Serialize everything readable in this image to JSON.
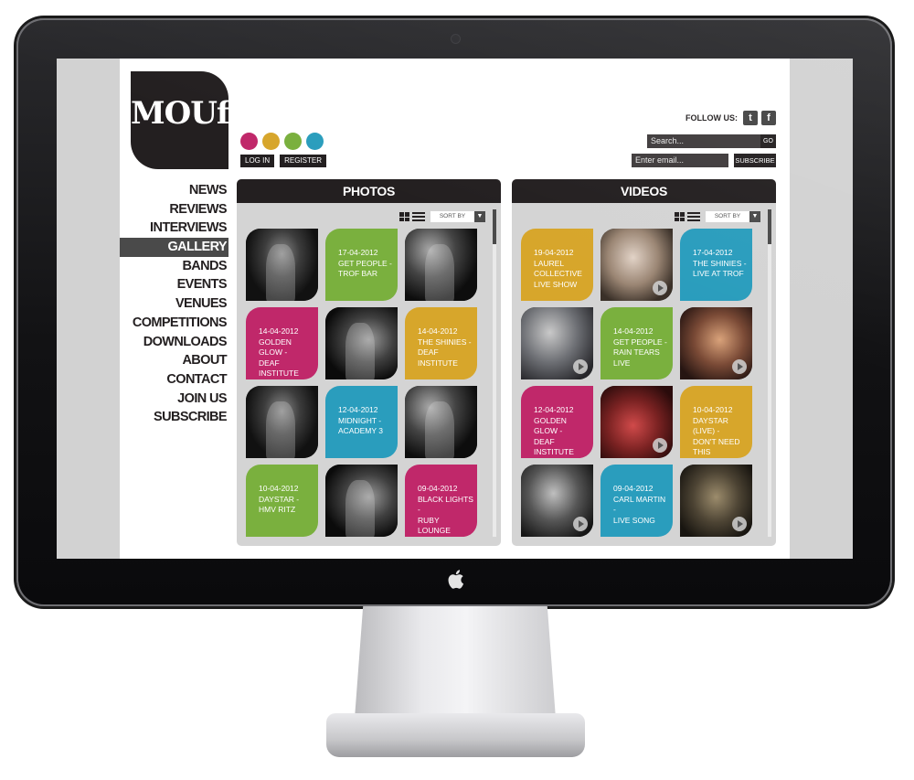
{
  "site": {
    "logo": "MOUf",
    "dots": [
      "#c0286a",
      "#d7a62b",
      "#7ab03e",
      "#2a9dbd"
    ],
    "auth": [
      "LOG IN",
      "REGISTER"
    ],
    "follow_label": "FOLLOW US:",
    "social": [
      {
        "icon": "twitter-icon",
        "glyph": "t"
      },
      {
        "icon": "facebook-icon",
        "glyph": "f"
      }
    ],
    "search": {
      "placeholder": "Search...",
      "go": "GO"
    },
    "newsletter": {
      "placeholder": "Enter email...",
      "button": "SUBSCRIBE"
    }
  },
  "nav": {
    "items": [
      "NEWS",
      "REVIEWS",
      "INTERVIEWS",
      "GALLERY",
      "BANDS",
      "EVENTS",
      "VENUES",
      "COMPETITIONS",
      "DOWNLOADS",
      "ABOUT",
      "CONTACT",
      "JOIN US",
      "SUBSCRIBE"
    ],
    "active": "GALLERY"
  },
  "photos": {
    "title": "PHOTOS",
    "sort_label": "SORT BY",
    "tiles": [
      {
        "kind": "photo"
      },
      {
        "kind": "text",
        "color": "#7ab03e",
        "lines": [
          "17-04-2012",
          "GET PEOPLE -",
          "TROF BAR"
        ]
      },
      {
        "kind": "photo"
      },
      {
        "kind": "text",
        "color": "#c0286a",
        "lines": [
          "14-04-2012",
          "GOLDEN GLOW -",
          "DEAF INSTITUTE"
        ]
      },
      {
        "kind": "photo"
      },
      {
        "kind": "text",
        "color": "#d7a62b",
        "lines": [
          "14-04-2012",
          "THE SHINIES -",
          "DEAF INSTITUTE"
        ]
      },
      {
        "kind": "photo"
      },
      {
        "kind": "text",
        "color": "#2a9dbd",
        "lines": [
          "12-04-2012",
          "MIDNIGHT -",
          "ACADEMY 3"
        ]
      },
      {
        "kind": "photo"
      },
      {
        "kind": "text",
        "color": "#7ab03e",
        "lines": [
          "10-04-2012",
          "DAYSTAR -",
          "HMV RITZ"
        ]
      },
      {
        "kind": "photo"
      },
      {
        "kind": "text",
        "color": "#c0286a",
        "lines": [
          "09-04-2012",
          "BLACK LIGHTS -",
          "RUBY LOUNGE"
        ]
      }
    ]
  },
  "videos": {
    "title": "VIDEOS",
    "sort_label": "SORT BY",
    "tiles": [
      {
        "kind": "text",
        "color": "#d7a62b",
        "lines": [
          "19-04-2012",
          "LAUREL",
          "COLLECTIVE",
          "LIVE SHOW"
        ]
      },
      {
        "kind": "video"
      },
      {
        "kind": "text",
        "color": "#2a9dbd",
        "lines": [
          "17-04-2012",
          "THE SHINIES -",
          "LIVE AT TROF"
        ]
      },
      {
        "kind": "video"
      },
      {
        "kind": "text",
        "color": "#7ab03e",
        "lines": [
          "14-04-2012",
          "GET PEOPLE -",
          "RAIN TEARS LIVE"
        ]
      },
      {
        "kind": "video"
      },
      {
        "kind": "text",
        "color": "#c0286a",
        "lines": [
          "12-04-2012",
          "GOLDEN GLOW -",
          "DEAF INSTITUTE"
        ]
      },
      {
        "kind": "video"
      },
      {
        "kind": "text",
        "color": "#d7a62b",
        "lines": [
          "10-04-2012",
          "DAYSTAR (LIVE) -",
          "DON'T NEED THIS"
        ]
      },
      {
        "kind": "video"
      },
      {
        "kind": "text",
        "color": "#2a9dbd",
        "lines": [
          "09-04-2012",
          "CARL MARTIN -",
          "LIVE SONG"
        ]
      },
      {
        "kind": "video"
      }
    ]
  }
}
